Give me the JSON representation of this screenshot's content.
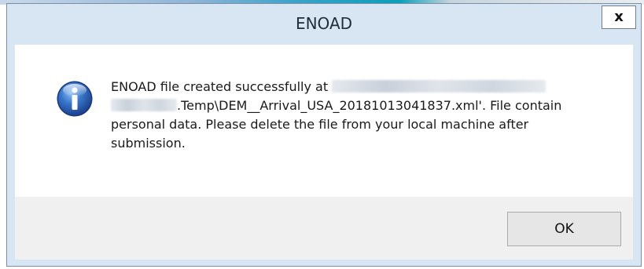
{
  "window": {
    "title": "ENOAD",
    "close_glyph": "x"
  },
  "message": {
    "line1": "ENOAD file created successfully at ",
    "line2": ".Temp\\DEM__Arrival_USA_20181013041837.xml'. File contain",
    "line3": "personal data. Please delete the file from your local machine after",
    "line4": "submission."
  },
  "icons": {
    "info": "information-icon",
    "close": "close-icon"
  },
  "buttons": {
    "ok_label": "OK"
  },
  "colors": {
    "title_bar": "#d8e6f3",
    "content_bg": "#ffffff",
    "footer_bg": "#f0f0f0",
    "info_icon_blue": "#2d63b8"
  }
}
